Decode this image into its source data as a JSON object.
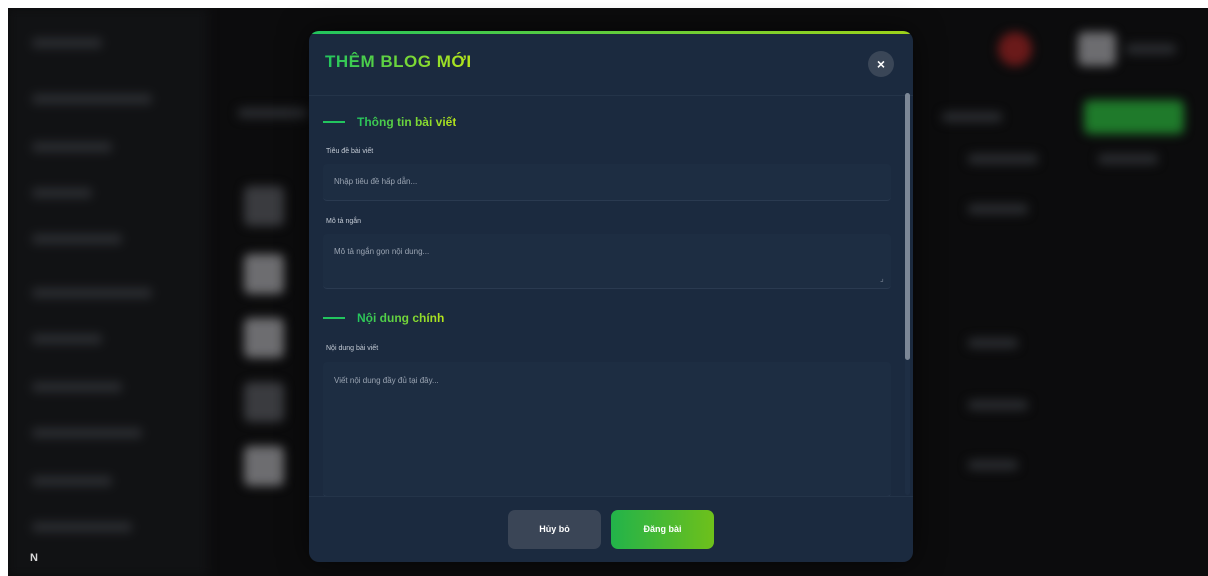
{
  "modal": {
    "title": "THÊM BLOG MỚI",
    "close_label": "×",
    "sections": [
      {
        "label": "Thông tin bài viết",
        "fields": [
          {
            "label": "Tiêu đề bài viết",
            "placeholder": "Nhập tiêu đề hấp dẫn..."
          },
          {
            "label": "Mô tả ngắn",
            "placeholder": "Mô tả ngắn gọn nội dung..."
          }
        ]
      },
      {
        "label": "Nội dung chính",
        "fields": [
          {
            "label": "Nội dung bài viết",
            "placeholder": "Viết nội dung đầy đủ tại đây..."
          }
        ]
      }
    ],
    "cancel_label": "Hủy bỏ",
    "submit_label": "Đăng bài"
  },
  "background": {
    "corner_mark": "N"
  },
  "colors": {
    "modal_bg": "#1b2a3f",
    "accent_start": "#22c55e",
    "accent_end": "#9ed21a",
    "cancel_bg": "#3a4556"
  },
  "icons": {
    "close": "close-icon",
    "resize": "resize-handle-icon"
  }
}
